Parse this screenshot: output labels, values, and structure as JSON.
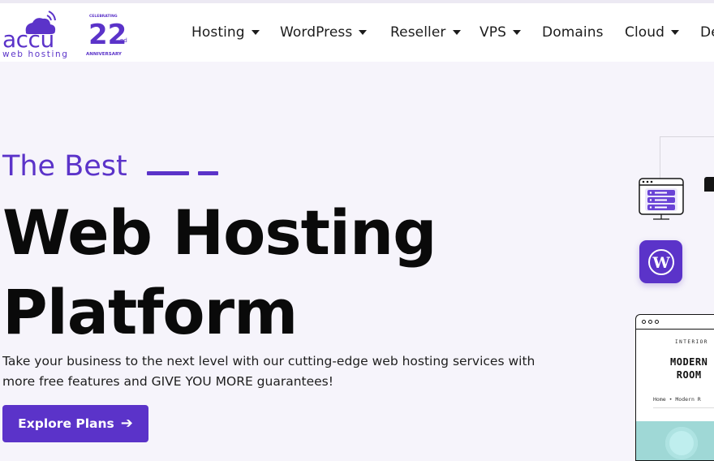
{
  "brand": {
    "name": "accu",
    "tagline": "web hosting",
    "anniversary_top": "CELEBRATING",
    "anniversary_number": "22",
    "anniversary_suffix": "nd",
    "anniversary_bottom": "ANNIVERSARY",
    "color": "#5b33c9"
  },
  "nav": {
    "items": [
      {
        "label": "Hosting",
        "dropdown": true
      },
      {
        "label": "WordPress",
        "dropdown": true
      },
      {
        "label": "Reseller",
        "dropdown": true
      },
      {
        "label": "VPS",
        "dropdown": true
      },
      {
        "label": "Domains",
        "dropdown": false
      },
      {
        "label": "Cloud",
        "dropdown": true
      },
      {
        "label": "De",
        "dropdown": false
      }
    ]
  },
  "hero": {
    "eyebrow": "The Best",
    "headline_line1": "Web Hosting",
    "headline_line2": "Platform",
    "subtext": "Take your business to the next level with our cutting-edge web hosting services with more free features and GIVE YOU MORE guarantees!",
    "cta_label": "Explore Plans",
    "cta_icon": "arrow-right-icon"
  },
  "illustration": {
    "site_card": {
      "category": "INTERIOR",
      "title_line1": "MODERN",
      "title_line2": "ROOM",
      "breadcrumb": "Home • Modern R"
    },
    "icons": [
      "server-icon",
      "wordpress-icon"
    ]
  },
  "colors": {
    "accent": "#5b33c9",
    "background": "#f6f4fb",
    "text": "#0a0a0a"
  }
}
